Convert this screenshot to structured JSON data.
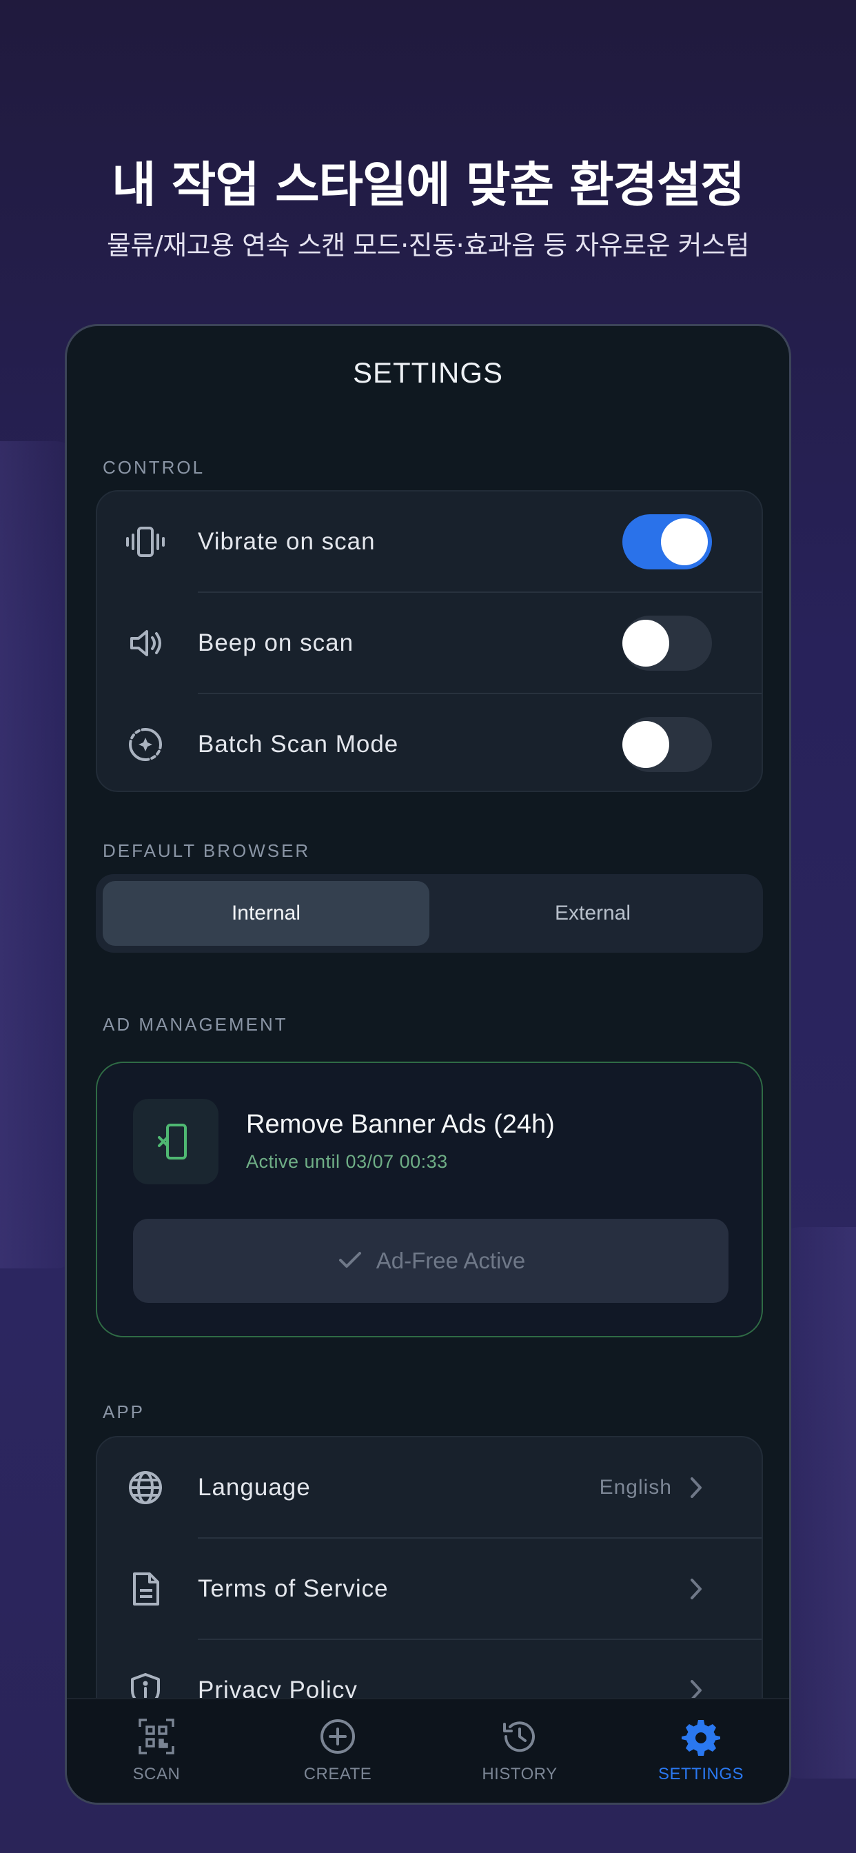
{
  "promo": {
    "headline": "내 작업 스타일에 맞춘 환경설정",
    "subheadline": "물류/재고용 연속 스캔 모드·진동·효과음 등 자유로운 커스텀"
  },
  "screen": {
    "title": "SETTINGS"
  },
  "control": {
    "section_label": "CONTROL",
    "items": [
      {
        "label": "Vibrate on scan",
        "icon": "vibrate-icon",
        "enabled": true
      },
      {
        "label": "Beep on scan",
        "icon": "speaker-icon",
        "enabled": false
      },
      {
        "label": "Batch Scan Mode",
        "icon": "batch-scan-icon",
        "enabled": false
      }
    ]
  },
  "browser": {
    "section_label": "DEFAULT BROWSER",
    "options": [
      "Internal",
      "External"
    ],
    "selected": "Internal"
  },
  "ads": {
    "section_label": "AD MANAGEMENT",
    "title": "Remove Banner Ads (24h)",
    "status": "Active until 03/07 00:33",
    "button_label": "Ad-Free Active",
    "icon": "phone-no-ads-icon"
  },
  "app": {
    "section_label": "APP",
    "items": [
      {
        "label": "Language",
        "value": "English",
        "icon": "globe-icon"
      },
      {
        "label": "Terms of Service",
        "icon": "document-icon"
      },
      {
        "label": "Privacy Policy",
        "icon": "shield-icon"
      }
    ]
  },
  "nav": {
    "items": [
      {
        "label": "SCAN",
        "icon": "qr-scan-icon"
      },
      {
        "label": "CREATE",
        "icon": "plus-circle-icon"
      },
      {
        "label": "HISTORY",
        "icon": "history-icon"
      },
      {
        "label": "SETTINGS",
        "icon": "gear-icon"
      }
    ],
    "active": "SETTINGS"
  },
  "colors": {
    "accent": "#2a78f0",
    "toggle_on": "#2a72ea",
    "success": "#6fae86",
    "background": "#0f1820"
  }
}
